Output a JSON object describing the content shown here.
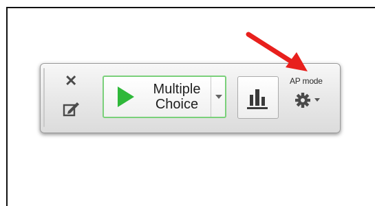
{
  "toolbar": {
    "close_icon": "close-x-icon",
    "edit_icon": "edit-pencil-icon",
    "poll_button": {
      "label_line1": "Multiple",
      "label_line2": "Choice",
      "icon": "play-icon"
    },
    "results_icon": "bar-chart-icon",
    "settings": {
      "label": "AP mode",
      "icon": "gear-icon"
    },
    "accent_color": "#2fb83a",
    "outline_color": "#7ad07a"
  },
  "annotation": {
    "arrow_color": "#e8201d"
  }
}
